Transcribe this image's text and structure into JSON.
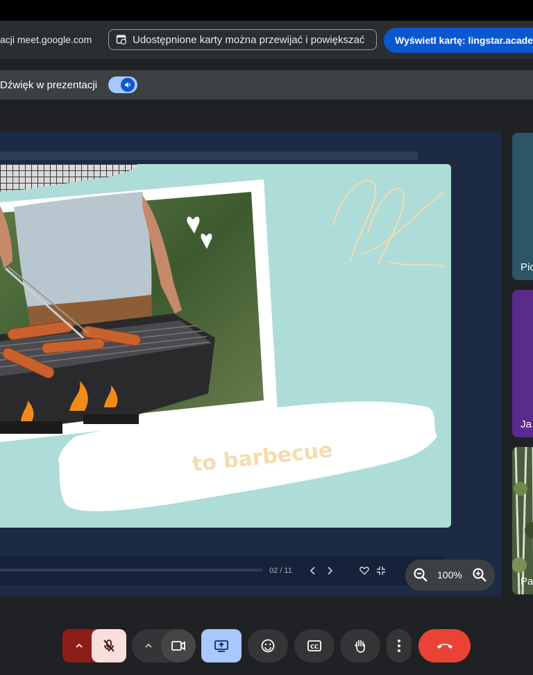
{
  "share_bar": {
    "origin_text": "acji meet.google.com",
    "info_text": "Udostępnione karty można przewijać i powiększać",
    "view_tab_label": "Wyświetl kartę: lingstar.academy"
  },
  "audio_bar": {
    "label": "Dźwięk w prezentacji",
    "toggle_on": true
  },
  "slide": {
    "caption": "to barbecue",
    "page_indicator": "02 / 11"
  },
  "zoom": {
    "value": "100%"
  },
  "participants": [
    {
      "name": "Pio"
    },
    {
      "name": "Ja"
    },
    {
      "name": "Pa"
    }
  ],
  "colors": {
    "accent": "#0b57d0",
    "end_call": "#ea4335",
    "mic_off_bg": "#f9dedc",
    "present_active": "#a8c7fa",
    "slide_bg": "#aedcd9"
  },
  "toolbar": {
    "icons": [
      "chevron-up-icon",
      "mic-off-icon",
      "chevron-up-icon",
      "camera-icon",
      "present-icon",
      "emoji-icon",
      "captions-icon",
      "raise-hand-icon",
      "more-icon",
      "end-call-icon"
    ]
  }
}
